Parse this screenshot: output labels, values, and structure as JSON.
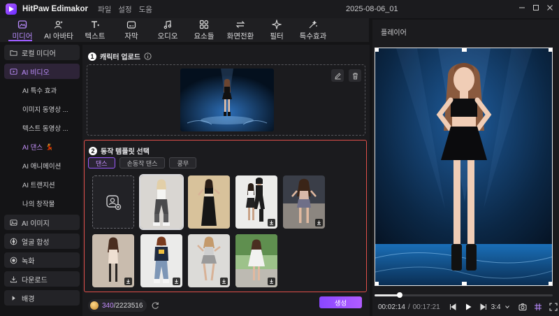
{
  "app": {
    "title": "HitPaw Edimakor",
    "menus": [
      "파일",
      "설정",
      "도움"
    ],
    "project_title": "2025-08-06_01"
  },
  "toolbar": {
    "items": [
      {
        "label": "미디어",
        "icon": "media-icon",
        "active": true
      },
      {
        "label": "AI 아바타",
        "icon": "avatar-icon"
      },
      {
        "label": "텍스트",
        "icon": "text-icon"
      },
      {
        "label": "자막",
        "icon": "subtitle-icon"
      },
      {
        "label": "오디오",
        "icon": "music-icon"
      },
      {
        "label": "요소들",
        "icon": "elements-icon"
      },
      {
        "label": "화면전환",
        "icon": "transition-icon"
      },
      {
        "label": "필터",
        "icon": "filter-icon"
      },
      {
        "label": "특수효과",
        "icon": "effects-icon"
      }
    ]
  },
  "sidebar": {
    "local_media": "로컬 미디어",
    "ai_video": "AI 비디오",
    "sub_items": [
      "AI 특수 효과",
      "이미지 동영상 ...",
      "텍스트 동영상 ...",
      "AI 댄스",
      "AI 애니메이션",
      "AI 트랜지션",
      "나의 창작물"
    ],
    "ai_image": "AI 이미지",
    "face_swap": "얼굴 합성",
    "record": "녹화",
    "download": "다운로드",
    "background": "배경"
  },
  "main": {
    "step1_num": "1",
    "step1_label": "캐릭터 업로드",
    "step2_num": "2",
    "step2_label": "동작 템플릿 선택",
    "tabs": [
      "댄스",
      "손동작 댄스",
      "쿵무"
    ],
    "credits_used": "340",
    "credits_total": "/2223516",
    "generate_label": "생성"
  },
  "player": {
    "title": "플레이어",
    "current_time": "00:02:14",
    "separator": "/",
    "total_time": "00:17:21",
    "aspect": "3:4",
    "progress": 0.14
  },
  "colors": {
    "accent": "#9d5cff",
    "highlight_border": "#e0504a"
  }
}
